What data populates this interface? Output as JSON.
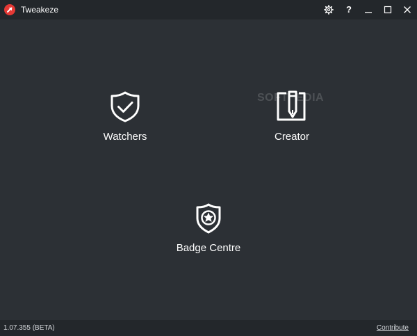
{
  "window": {
    "title": "Tweakeze",
    "logo_icon": "tweakeze-logo-icon",
    "controls": {
      "settings_icon": "gear-icon",
      "help_label": "?",
      "minimize_icon": "minimize-icon",
      "maximize_icon": "maximize-icon",
      "close_icon": "close-icon"
    }
  },
  "main": {
    "tiles": [
      {
        "label": "Watchers",
        "icon": "shield-check-icon"
      },
      {
        "label": "Creator",
        "icon": "notepad-pen-icon"
      },
      {
        "label": "Badge Centre",
        "icon": "badge-star-icon"
      }
    ],
    "watermark": "SOFTPEDIA"
  },
  "footer": {
    "version": "1.07.355 (BETA)",
    "contribute_label": "Contribute"
  },
  "colors": {
    "background": "#2c3035",
    "titlebar": "#23272b",
    "logo": "#e53935",
    "text": "#ffffff"
  }
}
